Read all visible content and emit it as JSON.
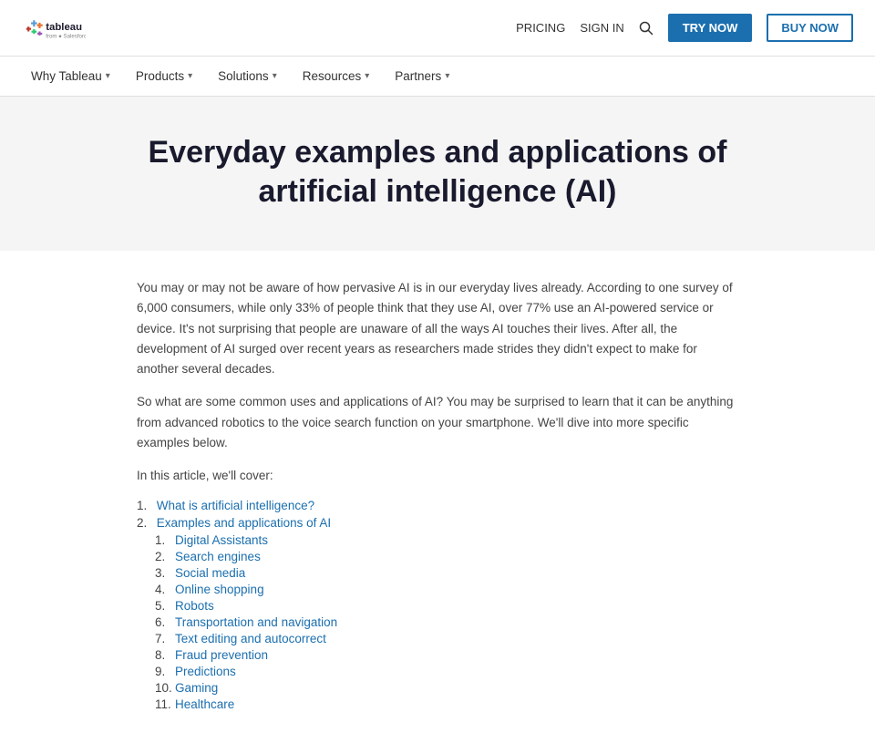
{
  "header": {
    "logo_text": "tableau",
    "logo_sub": "from Salesforce",
    "links": {
      "pricing": "PRICING",
      "signin": "SIGN IN"
    },
    "buttons": {
      "try": "TRY NOW",
      "buy": "BUY NOW"
    }
  },
  "nav": {
    "items": [
      {
        "label": "Why Tableau",
        "has_dropdown": true
      },
      {
        "label": "Products",
        "has_dropdown": true
      },
      {
        "label": "Solutions",
        "has_dropdown": true
      },
      {
        "label": "Resources",
        "has_dropdown": true
      },
      {
        "label": "Partners",
        "has_dropdown": true
      }
    ]
  },
  "hero": {
    "title": "Everyday examples and applications of artificial intelligence (AI)"
  },
  "content": {
    "para1": "You may or may not be aware of how pervasive AI is in our everyday lives already. According to one survey of 6,000 consumers, while only 33% of people think that they use AI, over 77% use an AI-powered service or device. It's not surprising that people are unaware of all the ways AI touches their lives. After all, the development of AI surged over recent years as researchers made strides they didn't expect to make for another several decades.",
    "para2": "So what are some common uses and applications of AI? You may be surprised to learn that it can be anything from advanced robotics to the voice search function on your smartphone. We'll dive into more specific examples below.",
    "toc_intro": "In this article, we'll cover:",
    "toc_items": [
      {
        "num": "1.",
        "label": "What is artificial intelligence?",
        "link": true,
        "sub_items": []
      },
      {
        "num": "2.",
        "label": "Examples and applications of AI",
        "link": true,
        "sub_items": [
          {
            "num": "1.",
            "label": "Digital Assistants",
            "link": true
          },
          {
            "num": "2.",
            "label": "Search engines",
            "link": true
          },
          {
            "num": "3.",
            "label": "Social media",
            "link": true
          },
          {
            "num": "4.",
            "label": "Online shopping",
            "link": true
          },
          {
            "num": "5.",
            "label": "Robots",
            "link": true
          },
          {
            "num": "6.",
            "label": "Transportation and navigation",
            "link": true
          },
          {
            "num": "7.",
            "label": "Text editing and autocorrect",
            "link": true
          },
          {
            "num": "8.",
            "label": "Fraud prevention",
            "link": true
          },
          {
            "num": "9.",
            "label": "Predictions",
            "link": true
          },
          {
            "num": "10.",
            "label": "Gaming",
            "link": true
          },
          {
            "num": "11.",
            "label": "Healthcare",
            "link": true
          }
        ]
      }
    ]
  }
}
